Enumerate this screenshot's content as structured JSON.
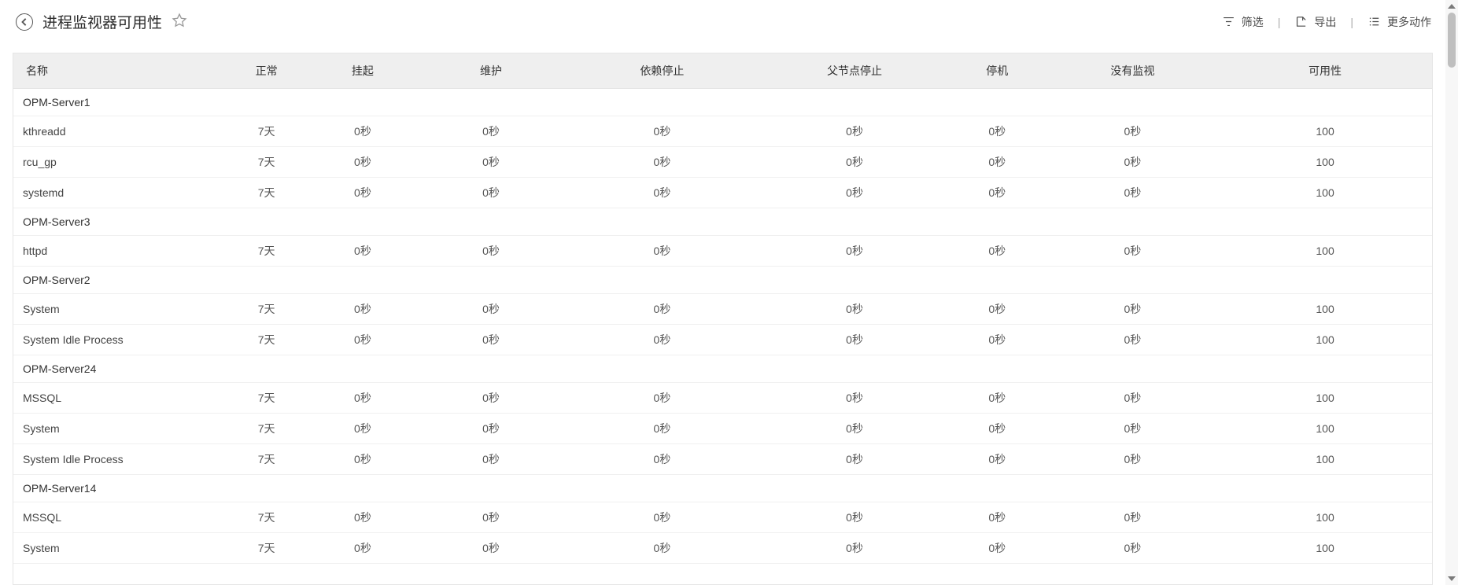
{
  "header": {
    "title": "进程监视器可用性"
  },
  "toolbar": {
    "filter": "筛选",
    "export": "导出",
    "more": "更多动作"
  },
  "columns": {
    "name": "名称",
    "normal": "正常",
    "hang": "挂起",
    "maintain": "维护",
    "dep_stop": "依赖停止",
    "parent_stop": "父节点停止",
    "down": "停机",
    "no_monitor": "没有监视",
    "avail": "可用性"
  },
  "groups": [
    {
      "name": "OPM-Server1",
      "rows": [
        {
          "name": "kthreadd",
          "normal": "7天",
          "hang": "0秒",
          "maintain": "0秒",
          "dep_stop": "0秒",
          "parent_stop": "0秒",
          "down": "0秒",
          "no_monitor": "0秒",
          "avail": "100"
        },
        {
          "name": "rcu_gp",
          "normal": "7天",
          "hang": "0秒",
          "maintain": "0秒",
          "dep_stop": "0秒",
          "parent_stop": "0秒",
          "down": "0秒",
          "no_monitor": "0秒",
          "avail": "100"
        },
        {
          "name": "systemd",
          "normal": "7天",
          "hang": "0秒",
          "maintain": "0秒",
          "dep_stop": "0秒",
          "parent_stop": "0秒",
          "down": "0秒",
          "no_monitor": "0秒",
          "avail": "100"
        }
      ]
    },
    {
      "name": "OPM-Server3",
      "rows": [
        {
          "name": "httpd",
          "normal": "7天",
          "hang": "0秒",
          "maintain": "0秒",
          "dep_stop": "0秒",
          "parent_stop": "0秒",
          "down": "0秒",
          "no_monitor": "0秒",
          "avail": "100"
        }
      ]
    },
    {
      "name": "OPM-Server2",
      "rows": [
        {
          "name": "System",
          "normal": "7天",
          "hang": "0秒",
          "maintain": "0秒",
          "dep_stop": "0秒",
          "parent_stop": "0秒",
          "down": "0秒",
          "no_monitor": "0秒",
          "avail": "100"
        },
        {
          "name": "System Idle Process",
          "normal": "7天",
          "hang": "0秒",
          "maintain": "0秒",
          "dep_stop": "0秒",
          "parent_stop": "0秒",
          "down": "0秒",
          "no_monitor": "0秒",
          "avail": "100"
        }
      ]
    },
    {
      "name": "OPM-Server24",
      "rows": [
        {
          "name": "MSSQL",
          "normal": "7天",
          "hang": "0秒",
          "maintain": "0秒",
          "dep_stop": "0秒",
          "parent_stop": "0秒",
          "down": "0秒",
          "no_monitor": "0秒",
          "avail": "100"
        },
        {
          "name": "System",
          "normal": "7天",
          "hang": "0秒",
          "maintain": "0秒",
          "dep_stop": "0秒",
          "parent_stop": "0秒",
          "down": "0秒",
          "no_monitor": "0秒",
          "avail": "100"
        },
        {
          "name": "System Idle Process",
          "normal": "7天",
          "hang": "0秒",
          "maintain": "0秒",
          "dep_stop": "0秒",
          "parent_stop": "0秒",
          "down": "0秒",
          "no_monitor": "0秒",
          "avail": "100"
        }
      ]
    },
    {
      "name": "OPM-Server14",
      "rows": [
        {
          "name": "MSSQL",
          "normal": "7天",
          "hang": "0秒",
          "maintain": "0秒",
          "dep_stop": "0秒",
          "parent_stop": "0秒",
          "down": "0秒",
          "no_monitor": "0秒",
          "avail": "100"
        },
        {
          "name": "System",
          "normal": "7天",
          "hang": "0秒",
          "maintain": "0秒",
          "dep_stop": "0秒",
          "parent_stop": "0秒",
          "down": "0秒",
          "no_monitor": "0秒",
          "avail": "100"
        }
      ]
    }
  ]
}
